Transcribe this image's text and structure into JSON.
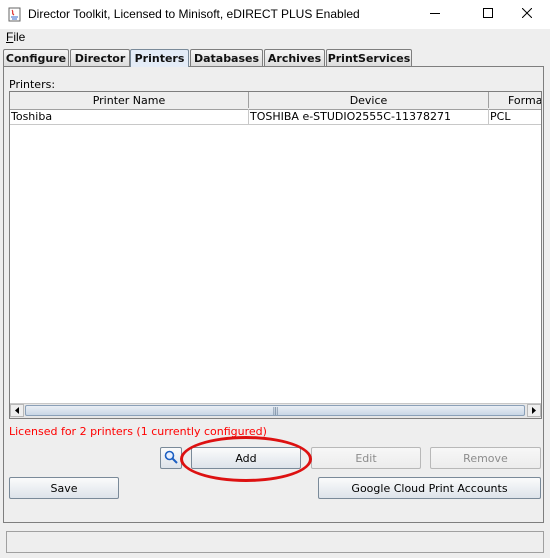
{
  "window": {
    "title": "Director Toolkit, Licensed to Minisoft, eDIRECT PLUS Enabled",
    "minimize_icon": "minimize-icon",
    "maximize_icon": "maximize-icon",
    "close_icon": "close-icon"
  },
  "menu": {
    "file_first": "F",
    "file_rest": "ile"
  },
  "tabs": [
    {
      "label": "Configure"
    },
    {
      "label": "Director"
    },
    {
      "label": "Printers"
    },
    {
      "label": "Databases"
    },
    {
      "label": "Archives"
    },
    {
      "label": "PrintServices"
    }
  ],
  "active_tab": "Printers",
  "printers": {
    "label": "Printers:",
    "columns": [
      "Printer Name",
      "Device",
      "Format"
    ],
    "rows": [
      {
        "name": "Toshiba",
        "device": "TOSHIBA e-STUDIO2555C-11378271",
        "format": "PCL"
      }
    ],
    "scroll_grip": "|||"
  },
  "license_note": "Licensed for 2 printers (1 currently configured)",
  "buttons": {
    "add": "Add",
    "edit": "Edit",
    "remove": "Remove",
    "save": "Save",
    "google": "Google Cloud Print Accounts"
  },
  "colors": {
    "license_note": "#ff0000",
    "highlight": "#dd1111"
  }
}
